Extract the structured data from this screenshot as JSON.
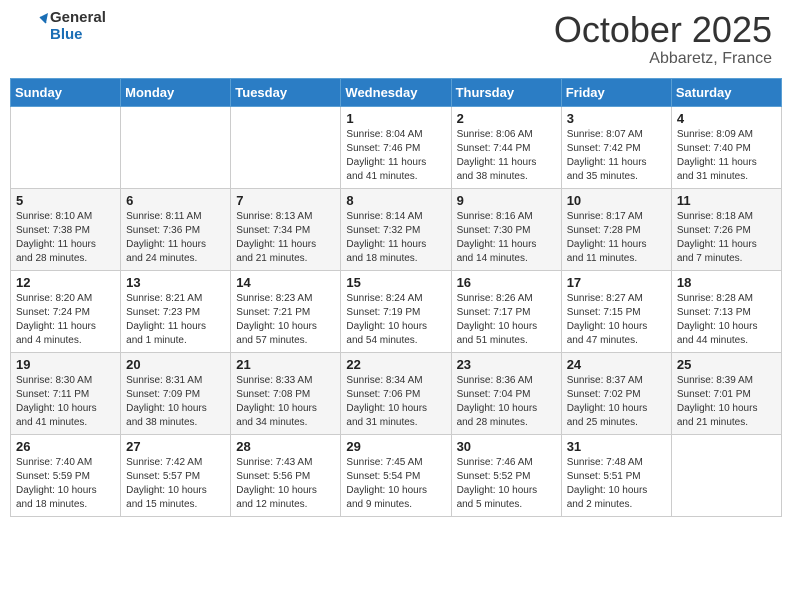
{
  "header": {
    "logo_general": "General",
    "logo_blue": "Blue",
    "month": "October 2025",
    "location": "Abbaretz, France"
  },
  "days_of_week": [
    "Sunday",
    "Monday",
    "Tuesday",
    "Wednesday",
    "Thursday",
    "Friday",
    "Saturday"
  ],
  "weeks": [
    [
      {
        "day": "",
        "info": ""
      },
      {
        "day": "",
        "info": ""
      },
      {
        "day": "",
        "info": ""
      },
      {
        "day": "1",
        "info": "Sunrise: 8:04 AM\nSunset: 7:46 PM\nDaylight: 11 hours\nand 41 minutes."
      },
      {
        "day": "2",
        "info": "Sunrise: 8:06 AM\nSunset: 7:44 PM\nDaylight: 11 hours\nand 38 minutes."
      },
      {
        "day": "3",
        "info": "Sunrise: 8:07 AM\nSunset: 7:42 PM\nDaylight: 11 hours\nand 35 minutes."
      },
      {
        "day": "4",
        "info": "Sunrise: 8:09 AM\nSunset: 7:40 PM\nDaylight: 11 hours\nand 31 minutes."
      }
    ],
    [
      {
        "day": "5",
        "info": "Sunrise: 8:10 AM\nSunset: 7:38 PM\nDaylight: 11 hours\nand 28 minutes."
      },
      {
        "day": "6",
        "info": "Sunrise: 8:11 AM\nSunset: 7:36 PM\nDaylight: 11 hours\nand 24 minutes."
      },
      {
        "day": "7",
        "info": "Sunrise: 8:13 AM\nSunset: 7:34 PM\nDaylight: 11 hours\nand 21 minutes."
      },
      {
        "day": "8",
        "info": "Sunrise: 8:14 AM\nSunset: 7:32 PM\nDaylight: 11 hours\nand 18 minutes."
      },
      {
        "day": "9",
        "info": "Sunrise: 8:16 AM\nSunset: 7:30 PM\nDaylight: 11 hours\nand 14 minutes."
      },
      {
        "day": "10",
        "info": "Sunrise: 8:17 AM\nSunset: 7:28 PM\nDaylight: 11 hours\nand 11 minutes."
      },
      {
        "day": "11",
        "info": "Sunrise: 8:18 AM\nSunset: 7:26 PM\nDaylight: 11 hours\nand 7 minutes."
      }
    ],
    [
      {
        "day": "12",
        "info": "Sunrise: 8:20 AM\nSunset: 7:24 PM\nDaylight: 11 hours\nand 4 minutes."
      },
      {
        "day": "13",
        "info": "Sunrise: 8:21 AM\nSunset: 7:23 PM\nDaylight: 11 hours\nand 1 minute."
      },
      {
        "day": "14",
        "info": "Sunrise: 8:23 AM\nSunset: 7:21 PM\nDaylight: 10 hours\nand 57 minutes."
      },
      {
        "day": "15",
        "info": "Sunrise: 8:24 AM\nSunset: 7:19 PM\nDaylight: 10 hours\nand 54 minutes."
      },
      {
        "day": "16",
        "info": "Sunrise: 8:26 AM\nSunset: 7:17 PM\nDaylight: 10 hours\nand 51 minutes."
      },
      {
        "day": "17",
        "info": "Sunrise: 8:27 AM\nSunset: 7:15 PM\nDaylight: 10 hours\nand 47 minutes."
      },
      {
        "day": "18",
        "info": "Sunrise: 8:28 AM\nSunset: 7:13 PM\nDaylight: 10 hours\nand 44 minutes."
      }
    ],
    [
      {
        "day": "19",
        "info": "Sunrise: 8:30 AM\nSunset: 7:11 PM\nDaylight: 10 hours\nand 41 minutes."
      },
      {
        "day": "20",
        "info": "Sunrise: 8:31 AM\nSunset: 7:09 PM\nDaylight: 10 hours\nand 38 minutes."
      },
      {
        "day": "21",
        "info": "Sunrise: 8:33 AM\nSunset: 7:08 PM\nDaylight: 10 hours\nand 34 minutes."
      },
      {
        "day": "22",
        "info": "Sunrise: 8:34 AM\nSunset: 7:06 PM\nDaylight: 10 hours\nand 31 minutes."
      },
      {
        "day": "23",
        "info": "Sunrise: 8:36 AM\nSunset: 7:04 PM\nDaylight: 10 hours\nand 28 minutes."
      },
      {
        "day": "24",
        "info": "Sunrise: 8:37 AM\nSunset: 7:02 PM\nDaylight: 10 hours\nand 25 minutes."
      },
      {
        "day": "25",
        "info": "Sunrise: 8:39 AM\nSunset: 7:01 PM\nDaylight: 10 hours\nand 21 minutes."
      }
    ],
    [
      {
        "day": "26",
        "info": "Sunrise: 7:40 AM\nSunset: 5:59 PM\nDaylight: 10 hours\nand 18 minutes."
      },
      {
        "day": "27",
        "info": "Sunrise: 7:42 AM\nSunset: 5:57 PM\nDaylight: 10 hours\nand 15 minutes."
      },
      {
        "day": "28",
        "info": "Sunrise: 7:43 AM\nSunset: 5:56 PM\nDaylight: 10 hours\nand 12 minutes."
      },
      {
        "day": "29",
        "info": "Sunrise: 7:45 AM\nSunset: 5:54 PM\nDaylight: 10 hours\nand 9 minutes."
      },
      {
        "day": "30",
        "info": "Sunrise: 7:46 AM\nSunset: 5:52 PM\nDaylight: 10 hours\nand 5 minutes."
      },
      {
        "day": "31",
        "info": "Sunrise: 7:48 AM\nSunset: 5:51 PM\nDaylight: 10 hours\nand 2 minutes."
      },
      {
        "day": "",
        "info": ""
      }
    ]
  ]
}
